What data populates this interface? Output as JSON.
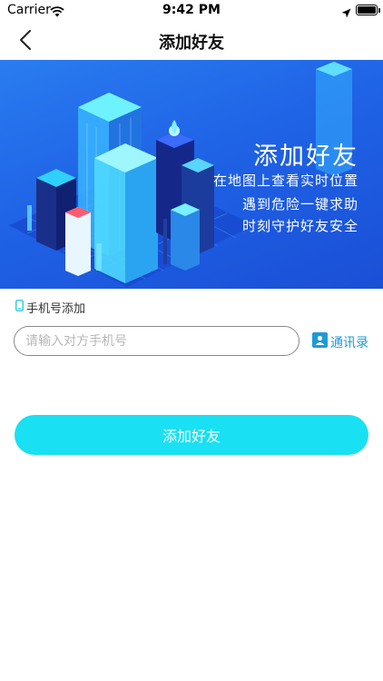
{
  "status_bar": {
    "carrier": "Carrier",
    "time": "9:42 PM",
    "icons": [
      "wifi-icon",
      "location-arrow-icon",
      "battery-icon"
    ]
  },
  "nav": {
    "title": "添加好友",
    "back_icon": "chevron-left-icon"
  },
  "banner": {
    "title": "添加好友",
    "lines": [
      "在地图上查看实时位置",
      "遇到危险一键求助",
      "时刻守护好友安全"
    ]
  },
  "form": {
    "section_label": "手机号添加",
    "section_icon": "phone-icon",
    "phone_placeholder": "请输入对方手机号",
    "phone_value": "",
    "contacts_label": "通讯录",
    "contacts_icon": "contacts-book-icon",
    "submit_label": "添加好友"
  },
  "colors": {
    "accent": "#19e0f2",
    "link": "#1e9ad8",
    "banner": "#1f63e6"
  }
}
